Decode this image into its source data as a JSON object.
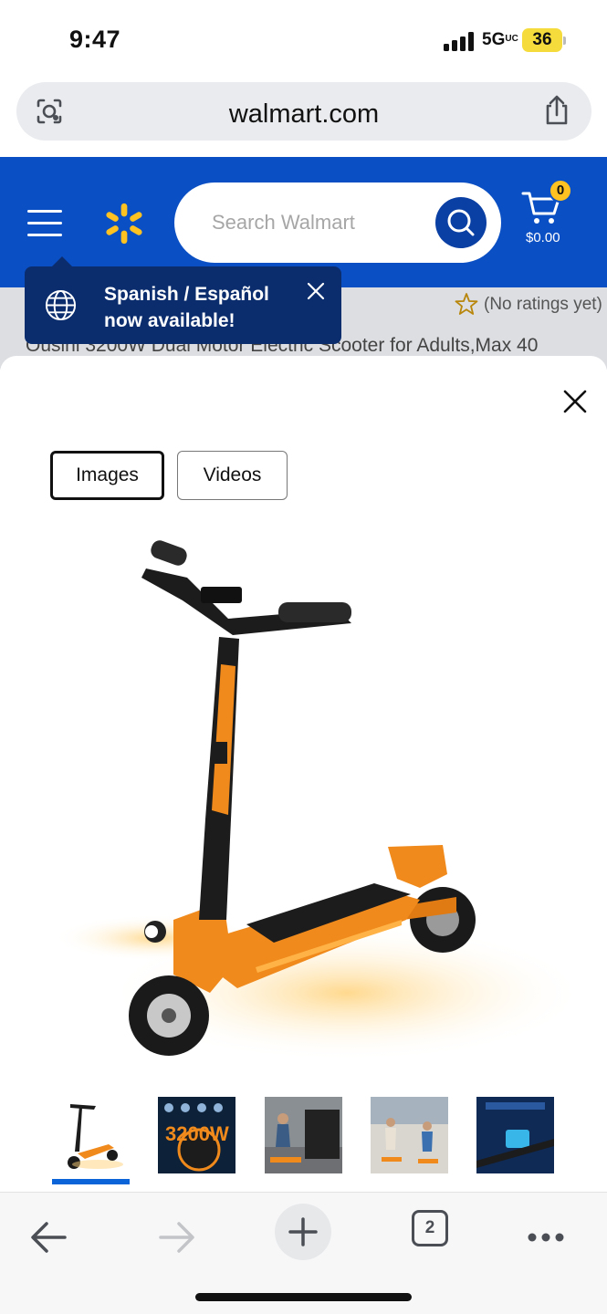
{
  "status_bar": {
    "time": "9:47",
    "network": "5G",
    "network_suffix": "UC",
    "battery": "36"
  },
  "browser": {
    "url": "walmart.com",
    "open_tabs": "2"
  },
  "header": {
    "brand_color": "#0b4fc4",
    "search_placeholder": "Search Walmart",
    "cart_count": "0",
    "cart_total": "$0.00"
  },
  "background_page": {
    "rating_text": "(No ratings yet)",
    "product_title": "Ousini 3200W Dual Motor Electric Scooter for Adults,Max 40"
  },
  "tooltip": {
    "line1": "Spanish / Español",
    "line2": "now available!"
  },
  "media_modal": {
    "tabs": [
      {
        "label": "Images",
        "selected": true
      },
      {
        "label": "Videos",
        "selected": false
      }
    ],
    "main_image_alt": "Orange and black electric scooter",
    "thumbnails": [
      {
        "name": "thumb-scooter-side",
        "selected": true
      },
      {
        "name": "thumb-motor-power",
        "selected": false
      },
      {
        "name": "thumb-riding-features",
        "selected": false
      },
      {
        "name": "thumb-riders-city",
        "selected": false
      },
      {
        "name": "thumb-lcd-display",
        "selected": false
      }
    ],
    "thumb_text": "3200W"
  },
  "toolbar": {
    "back_icon": "arrow-left-icon",
    "forward_icon": "arrow-right-icon",
    "new_tab_icon": "plus-icon",
    "more_icon": "ellipsis-icon"
  }
}
